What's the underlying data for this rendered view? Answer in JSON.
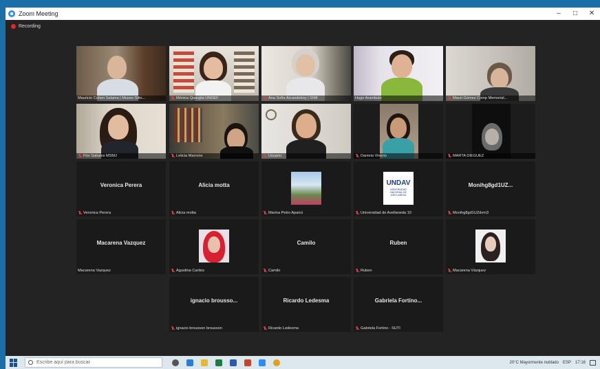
{
  "window": {
    "title": "Zoom Meeting",
    "minimize": "–",
    "maximize": "□",
    "close": "✕"
  },
  "recording": {
    "label": "Recording",
    "color": "#e02828"
  },
  "participants": [
    {
      "name": "Mauricio Cohen Salama | Museo Sitio...",
      "video": true
    },
    {
      "name": "Mónica Quargila UNDEF",
      "video": true
    },
    {
      "name": "Ana Sofía Arcandeboy | SIMI",
      "video": true
    },
    {
      "name": "Hugo Arambulo",
      "video": true
    },
    {
      "name": "Mauri Gómez Comp Memorial...",
      "video": true
    },
    {
      "name": "Flor Sabales MSMJ",
      "video": true
    },
    {
      "name": "Leticia Marrone",
      "video": true,
      "active": true
    },
    {
      "name": "Usuario",
      "video": true
    },
    {
      "name": "Daniela Vinerio",
      "video": true
    },
    {
      "name": "MARTA DIEGUEZ",
      "video": true
    },
    {
      "name": "Veronica Perera",
      "display": "Veronica Perera",
      "video": false
    },
    {
      "name": "Alicia motta",
      "display": "Alicia motta",
      "video": false
    },
    {
      "name": "Marina Petro Aparici",
      "video": false,
      "thumb": "photo"
    },
    {
      "name": "Universidad de Avellaneda 10",
      "video": false,
      "thumb": "undav"
    },
    {
      "name": "Monihg8gd1UZdvm3",
      "display": "Monihg8gd1UZ...",
      "video": false
    },
    {
      "name": "Macarena Vazquez",
      "display": "Macarena Vazquez",
      "video": false,
      "nomic": true
    },
    {
      "name": "Agustina Caritos",
      "video": false,
      "thumb": "redhair"
    },
    {
      "name": "Camilo",
      "display": "Camilo",
      "video": false
    },
    {
      "name": "Ruben",
      "display": "Ruben",
      "video": false
    },
    {
      "name": "Macarena Vázquez",
      "video": false,
      "thumb": "portrait"
    },
    {
      "name": "ignacio brousson brousson",
      "display": "ignacio broussо...",
      "video": false
    },
    {
      "name": "Ricardo Ledesma",
      "display": "Ricardo Ledesma",
      "video": false
    },
    {
      "name": "Gabriela Fortino - SUTI",
      "display": "Gabriela Fortino...",
      "video": false
    }
  ],
  "undav_logo": {
    "line1": "UNDAV",
    "line2": "UNIVERSIDAD",
    "line3": "NACIONAL DE",
    "line4": "AVELLANEDA"
  },
  "taskbar": {
    "search_placeholder": "Escribe aquí para buscar",
    "weather": "20°C Mayormente nublado",
    "language": "ESP",
    "time": "17:16"
  }
}
